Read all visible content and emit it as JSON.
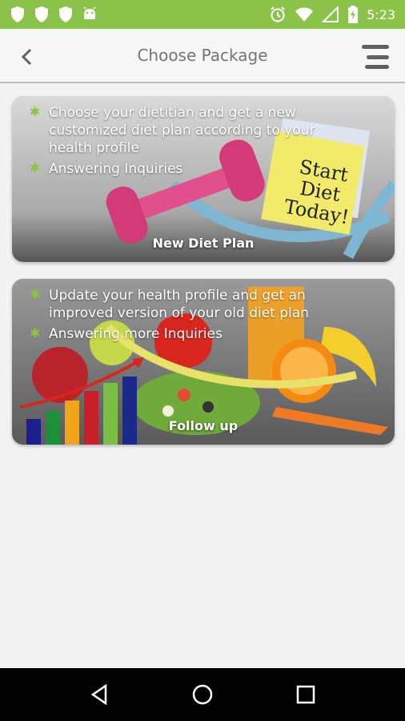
{
  "status_bar": {
    "time": "5:23",
    "icons": [
      "shield-icon",
      "shield-icon",
      "shield-icon",
      "android-icon",
      "alarm-icon",
      "wifi-icon",
      "signal-icon",
      "battery-charging-icon"
    ]
  },
  "app_bar": {
    "title": "Choose Package",
    "back_icon": "chevron-left-icon",
    "menu_icon": "menu-icon"
  },
  "packages": [
    {
      "bullets": [
        "Choose your dietitian and get a new customized diet plan according to your health profile",
        "Answering Inquiries"
      ],
      "label": "New Diet Plan",
      "note_text": [
        "Start",
        "Diet",
        "Today!"
      ]
    },
    {
      "bullets": [
        "Update your health profile and get an improved version of your old diet plan",
        "Answering more Inquiries"
      ],
      "label": "Follow up"
    }
  ],
  "nav_bar": {
    "icons": [
      "back-triangle-icon",
      "home-circle-icon",
      "recents-square-icon"
    ]
  },
  "colors": {
    "accent": "#8bc34a",
    "title": "#757575"
  }
}
